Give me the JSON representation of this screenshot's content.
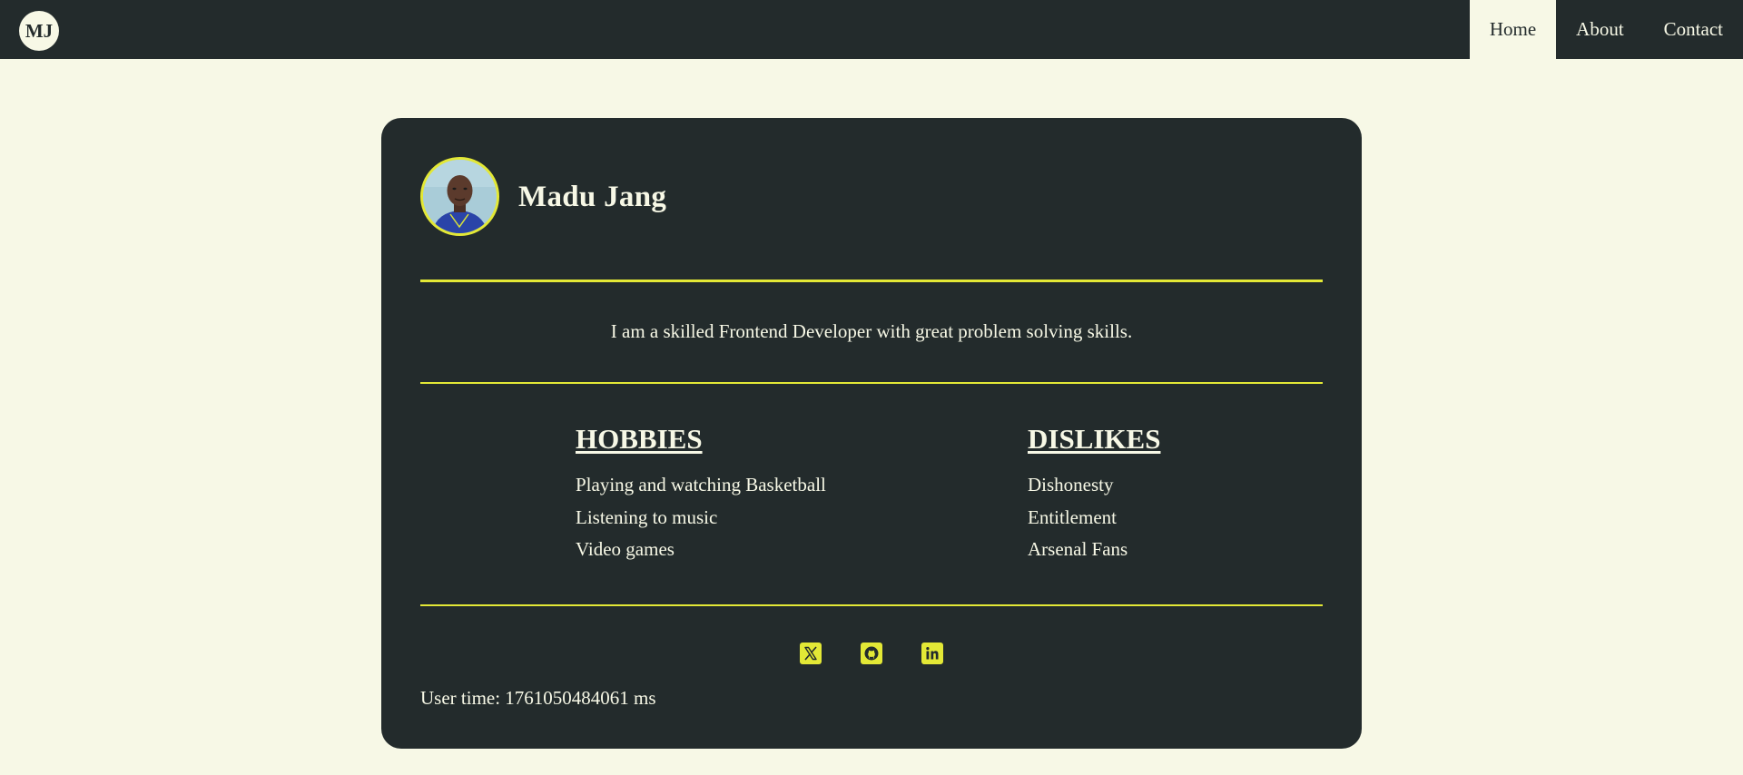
{
  "header": {
    "logo_text": "MJ",
    "nav": [
      {
        "label": "Home",
        "active": true
      },
      {
        "label": "About",
        "active": false
      },
      {
        "label": "Contact",
        "active": false
      }
    ]
  },
  "profile": {
    "name": "Madu Jang",
    "bio": "I am a skilled Frontend Developer with great problem solving skills."
  },
  "hobbies": {
    "heading": "HOBBIES",
    "items": [
      "Playing and watching Basketball",
      "Listening to music",
      "Video games"
    ]
  },
  "dislikes": {
    "heading": "DISLIKES",
    "items": [
      "Dishonesty",
      "Entitlement",
      "Arsenal Fans"
    ]
  },
  "socials": [
    {
      "icon": "x-twitter-icon"
    },
    {
      "icon": "github-icon"
    },
    {
      "icon": "linkedin-icon"
    }
  ],
  "footer": {
    "user_time": "User time: 1761050484061 ms"
  },
  "colors": {
    "page_background": "#f7f8e6",
    "card_background": "#232b2c",
    "accent": "#e3e836",
    "text_light": "#f7f8e6"
  }
}
